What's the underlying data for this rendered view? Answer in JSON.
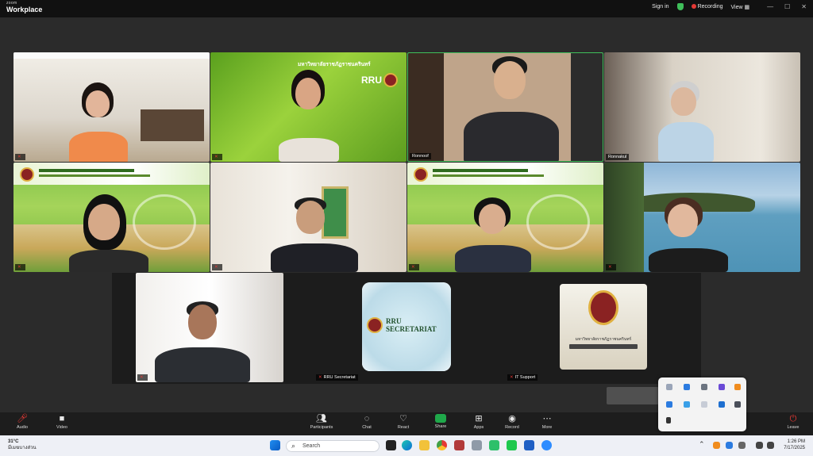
{
  "titlebar": {
    "brand_small": "zoom",
    "brand_big": "Workplace",
    "sign_in": "Sign in",
    "recording": "Recording",
    "view": "View"
  },
  "tiles": {
    "t3": {
      "name": "Ronnoof"
    },
    "t4": {
      "name": "Ronnakul"
    },
    "t12": {
      "name": "RRU Secretariat",
      "logo_line1": "RRU",
      "logo_line2": "SECRETARIAT"
    },
    "t13": {
      "name": "IT Support",
      "caption": "มหาวิทยาลัยราชภัฏราชนครินทร์"
    },
    "t2": {
      "banner_thai": "มหาวิทยาลัยราชภัฏราชนครินทร์",
      "banner_rru": "RRU"
    }
  },
  "toolbar": {
    "audio": "Audio",
    "video": "Video",
    "participants": "Participants",
    "chat": "Chat",
    "react": "React",
    "share": "Share",
    "apps": "Apps",
    "record": "Record",
    "more": "More",
    "leave": "Leave"
  },
  "taskbar": {
    "weather_temp": "31°C",
    "weather_desc": "มีเมฆบางส่วน",
    "search_placeholder": "Search",
    "time": "1:26 PM",
    "date": "7/17/2025"
  },
  "colors": {
    "active_speaker_border": "#3fbf5a",
    "record_red": "#e53935",
    "campus_green": "#7fc24a"
  }
}
